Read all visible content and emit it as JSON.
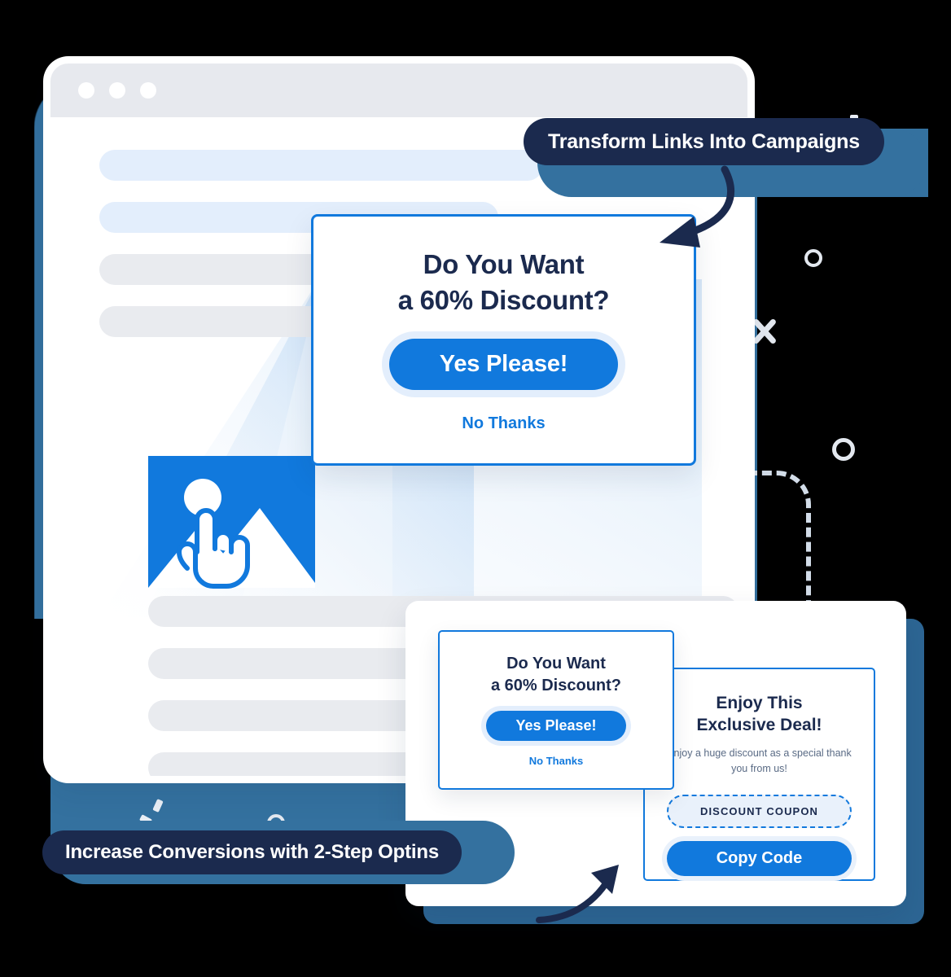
{
  "colors": {
    "navy": "#1b2a4e",
    "accent_blue": "#1179dd",
    "shadow_blue": "#34719f",
    "light_blue_ring": "#e3eefc",
    "skeleton_grey": "#e9ebef",
    "background": "#000000"
  },
  "browser": {
    "titlebar_dots": [
      "dot-1",
      "dot-2",
      "dot-3"
    ],
    "skeleton_lines_upper": [
      "line-1",
      "line-2",
      "line-3",
      "line-4"
    ],
    "skeleton_lines_lower": [
      "line-5",
      "line-6",
      "line-7",
      "line-8",
      "line-9"
    ],
    "image_placeholder_icon": "image-placeholder-icon",
    "cursor_icon": "pointing-hand-cursor-icon"
  },
  "badges": [
    {
      "id": "transform",
      "label": "Transform Links Into Campaigns"
    },
    {
      "id": "conversions",
      "label": "Increase Conversions with 2-Step Optins"
    }
  ],
  "popup_main": {
    "title_line1": "Do You Want",
    "title_line2": "a 60% Discount?",
    "primary_button": "Yes Please!",
    "decline_link": "No Thanks"
  },
  "popup_small": {
    "title_line1": "Do You Want",
    "title_line2": "a 60% Discount?",
    "primary_button": "Yes Please!",
    "decline_link": "No Thanks"
  },
  "deal_card": {
    "title_line1": "Enjoy This",
    "title_line2": "Exclusive Deal!",
    "subtitle": "Enjoy a huge discount as a special thank you from us!",
    "coupon_label": "DISCOUNT COUPON",
    "copy_button": "Copy Code"
  },
  "decorations": {
    "ring_top": "ring-icon",
    "ring_mid": "ring-icon",
    "cross": "cross-icon",
    "dashed_elbow": "dashed-elbow-path",
    "arrow_top": "curved-arrow-down-left-icon",
    "arrow_bottom": "curved-arrow-up-right-icon"
  }
}
